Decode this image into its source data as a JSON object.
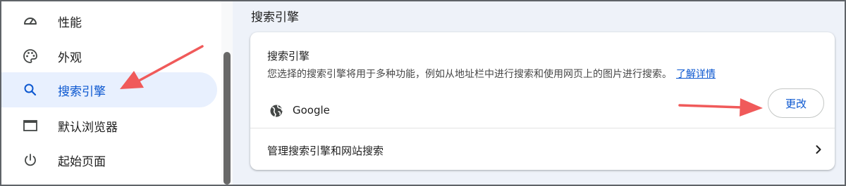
{
  "sidebar": {
    "items": [
      {
        "label": "性能",
        "icon": "speedometer-icon"
      },
      {
        "label": "外观",
        "icon": "palette-icon"
      },
      {
        "label": "搜索引擎",
        "icon": "search-icon"
      },
      {
        "label": "默认浏览器",
        "icon": "browser-window-icon"
      },
      {
        "label": "起始页面",
        "icon": "power-icon"
      }
    ],
    "active_index": 2
  },
  "main": {
    "section_title": "搜索引擎",
    "card": {
      "title": "搜索引擎",
      "description": "您选择的搜索引擎将用于多种功能，例如从地址栏中进行搜索和使用网页上的图片进行搜索。",
      "learn_more": "了解详情",
      "engine": {
        "icon": "globe-icon",
        "name": "Google"
      },
      "change_button": "更改",
      "manage_label": "管理搜索引擎和网站搜索",
      "manage_icon": "chevron-right-icon"
    }
  },
  "colors": {
    "accent": "#0b57d0",
    "active_bg": "#e8f0fe",
    "annotation_arrow": "#f05a5a"
  }
}
